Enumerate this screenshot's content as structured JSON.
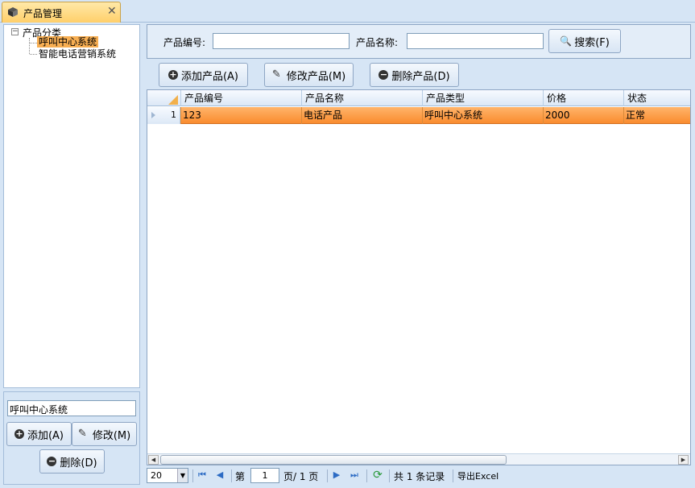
{
  "tab": {
    "title": "产品管理",
    "icon": "box-icon",
    "close_icon": "close-icon"
  },
  "tree": {
    "root": "产品分类",
    "children": [
      "呼叫中心系统",
      "智能电话营销系统"
    ],
    "selected_index": 0
  },
  "category_form": {
    "input_value": "呼叫中心系统",
    "add_label": "添加(A)",
    "edit_label": "修改(M)",
    "delete_label": "删除(D)"
  },
  "search": {
    "code_label": "产品编号:",
    "code_value": "",
    "name_label": "产品名称:",
    "name_value": "",
    "search_label": "搜索(F)"
  },
  "toolbar": {
    "add_label": "添加产品(A)",
    "edit_label": "修改产品(M)",
    "delete_label": "删除产品(D)"
  },
  "grid": {
    "columns": [
      "产品编号",
      "产品名称",
      "产品类型",
      "价格",
      "状态"
    ],
    "rows": [
      {
        "num": "1",
        "cells": [
          "123",
          "电话产品",
          "呼叫中心系统",
          "2000",
          "正常"
        ]
      }
    ]
  },
  "pager": {
    "page_size": "20",
    "page_prefix": "第",
    "current_page": "1",
    "page_suffix": "页/ 1 页",
    "record_count": "共 1 条记录",
    "export_label": "导出Excel"
  },
  "colors": {
    "accent_selected": "#fa8c2f",
    "tree_selected": "#f7ae52",
    "panel_bg": "#d6e5f5"
  }
}
